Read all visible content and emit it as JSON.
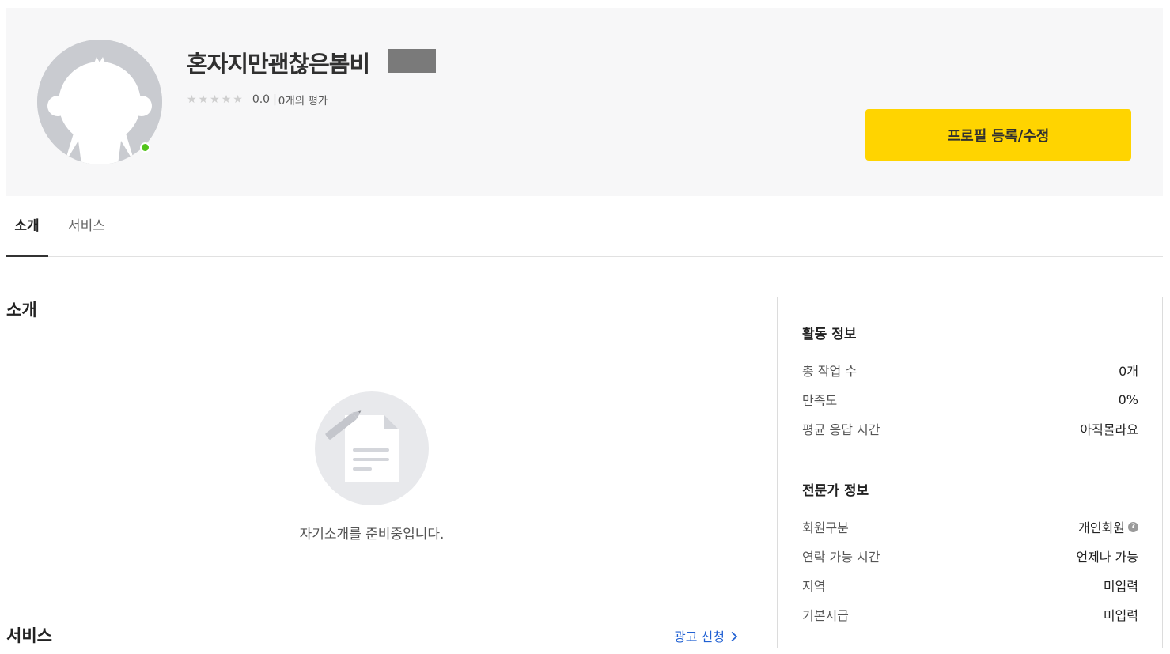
{
  "profile": {
    "name": "혼자지만괜찮은봄비",
    "rating_score": "0.0",
    "rating_separator": "|",
    "rating_count": "0개의 평가",
    "edit_button_label": "프로필 등록/수정"
  },
  "tabs": [
    {
      "label": "소개"
    },
    {
      "label": "서비스"
    }
  ],
  "intro": {
    "title": "소개",
    "empty_message": "자기소개를 준비중입니다."
  },
  "service": {
    "title": "서비스",
    "ad_link": "광고 신청"
  },
  "activity": {
    "heading": "활동 정보",
    "rows": [
      {
        "label": "총 작업 수",
        "value": "0개"
      },
      {
        "label": "만족도",
        "value": "0%"
      },
      {
        "label": "평균 응답 시간",
        "value": "아직몰라요"
      }
    ]
  },
  "expert": {
    "heading": "전문가 정보",
    "rows": [
      {
        "label": "회원구분",
        "value": "개인회원"
      },
      {
        "label": "연락 가능 시간",
        "value": "언제나 가능"
      },
      {
        "label": "지역",
        "value": "미입력"
      },
      {
        "label": "기본시급",
        "value": "미입력"
      }
    ]
  },
  "colors": {
    "accent_button": "#ffd400",
    "online_status": "#52c41a",
    "link": "#2161d3"
  },
  "icons": {
    "help": "question-circle-icon",
    "chevron": "chevron-right-icon",
    "star": "star-icon"
  }
}
